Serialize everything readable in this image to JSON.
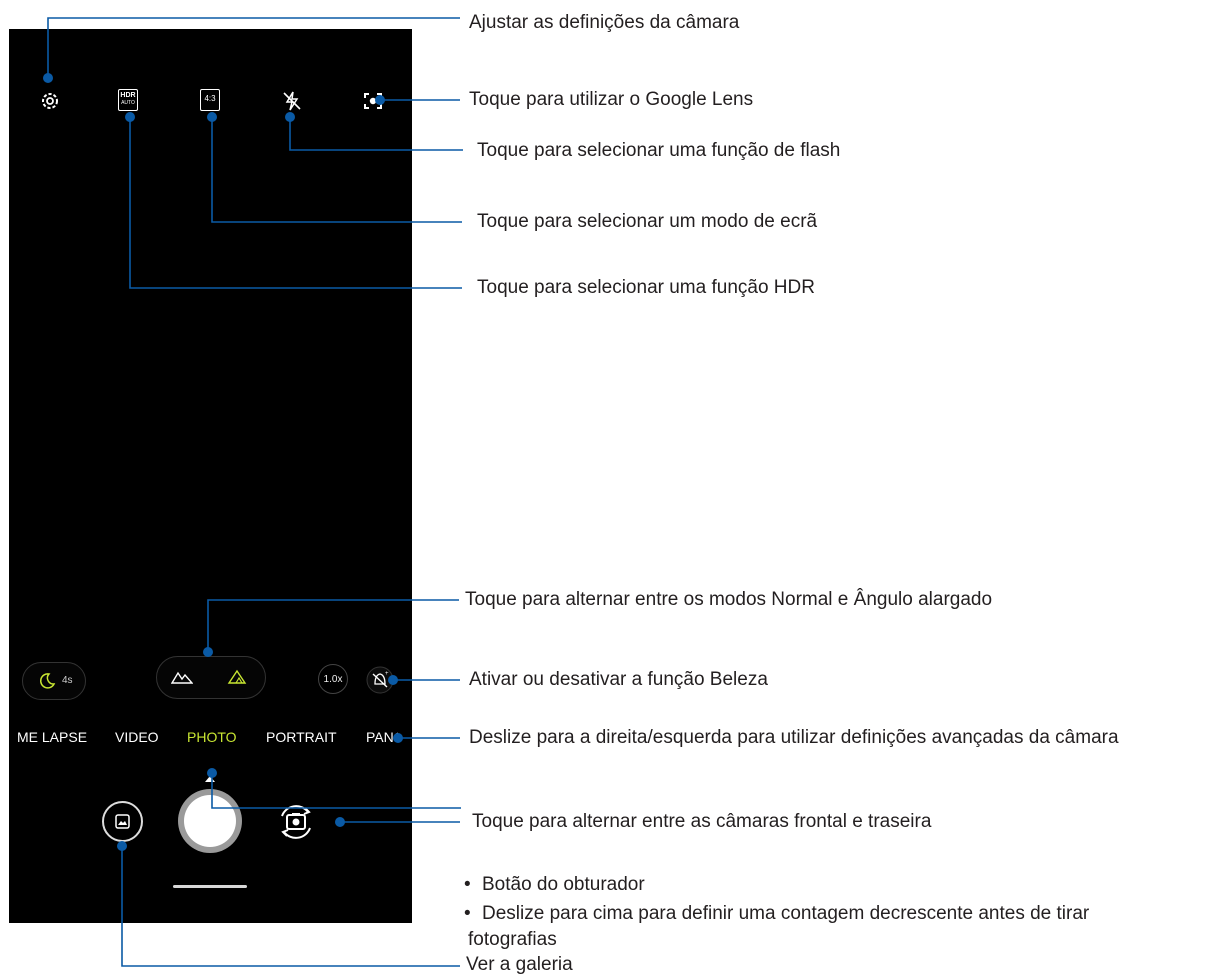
{
  "colors": {
    "accent": "#c8e632",
    "callout_line": "#0a5aa5",
    "screen_bg": "#000000"
  },
  "top_bar": {
    "icons": [
      "settings-icon",
      "hdr-auto-icon",
      "aspect-ratio-icon",
      "flash-off-icon",
      "google-lens-icon"
    ],
    "hdr_label_top": "HDR",
    "hdr_label_bottom": "AUTO",
    "aspect_label": "4:3"
  },
  "controls": {
    "night_timer": "4s",
    "zoom": "1.0x"
  },
  "modes": {
    "items": [
      "ME LAPSE",
      "VIDEO",
      "PHOTO",
      "PORTRAIT",
      "PANO"
    ],
    "selected": "PHOTO"
  },
  "callouts": {
    "settings": "Ajustar as definições da câmara",
    "lens": "Toque para utilizar o Google Lens",
    "flash": "Toque para selecionar uma função de flash",
    "screen_mode": "Toque para selecionar um modo de ecrã",
    "hdr": "Toque para selecionar uma função HDR",
    "lens_mode": "Toque para alternar entre os modos Normal e Ângulo alargado",
    "beauty": "Ativar ou desativar a função Beleza",
    "swipe_modes": "Deslize para a direita/esquerda para utilizar definições avançadas da câmara",
    "switch_camera": "Toque para alternar entre as câmaras frontal e traseira",
    "shutter_1": "Botão do obturador",
    "shutter_2a": "Deslize para cima para definir uma contagem decrescente antes de tirar",
    "shutter_2b": "fotografias",
    "gallery": "Ver a galeria"
  }
}
